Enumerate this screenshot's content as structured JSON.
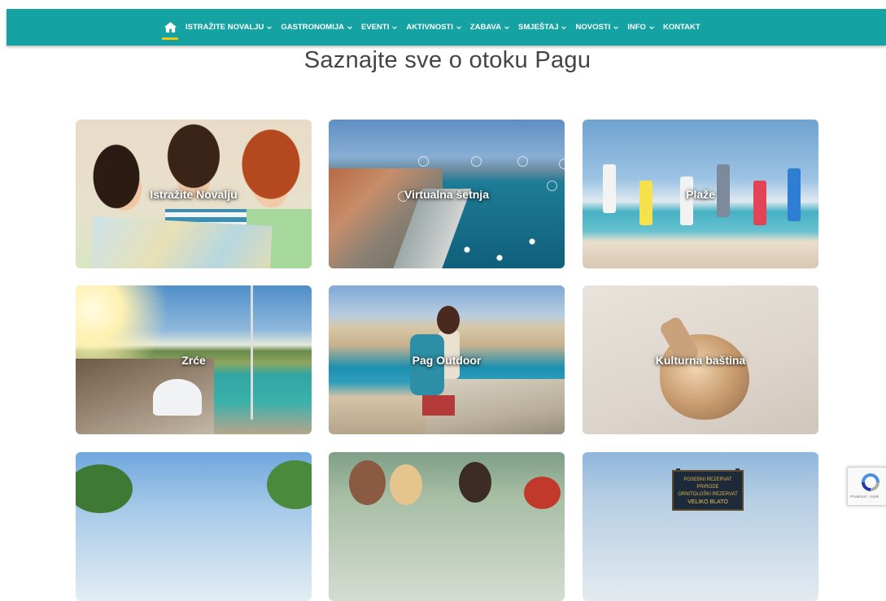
{
  "nav": {
    "home_icon": "home-icon",
    "items": [
      {
        "label": "ISTRAŽITE NOVALJU",
        "dropdown": true
      },
      {
        "label": "GASTRONOMIJA",
        "dropdown": true
      },
      {
        "label": "EVENTI",
        "dropdown": true
      },
      {
        "label": "AKTIVNOSTI",
        "dropdown": true
      },
      {
        "label": "ZABAVA",
        "dropdown": true
      },
      {
        "label": "SMJEŠTAJ",
        "dropdown": true
      },
      {
        "label": "NOVOSTI",
        "dropdown": true
      },
      {
        "label": "INFO",
        "dropdown": true
      },
      {
        "label": "KONTAKT",
        "dropdown": false
      }
    ]
  },
  "page_title": "Saznajte sve o otoku Pagu",
  "tiles": [
    {
      "label": "Istražite Novalju"
    },
    {
      "label": "Virtualna šetnja"
    },
    {
      "label": "Plaže"
    },
    {
      "label": "Zrće"
    },
    {
      "label": "Pag Outdoor"
    },
    {
      "label": "Kulturna baština"
    },
    {
      "label": ""
    },
    {
      "label": ""
    },
    {
      "label": ""
    }
  ],
  "sign_text": [
    "POSEBNI REZERVAT PRIRODE",
    "ORNITOLOŠKI REZERVAT",
    "VELIKO BLATO"
  ],
  "recaptcha_text": "Privatnost - Uvjeti",
  "colors": {
    "nav_bg": "#14a2a2",
    "nav_accent": "#f1c40f",
    "title": "#444444"
  }
}
